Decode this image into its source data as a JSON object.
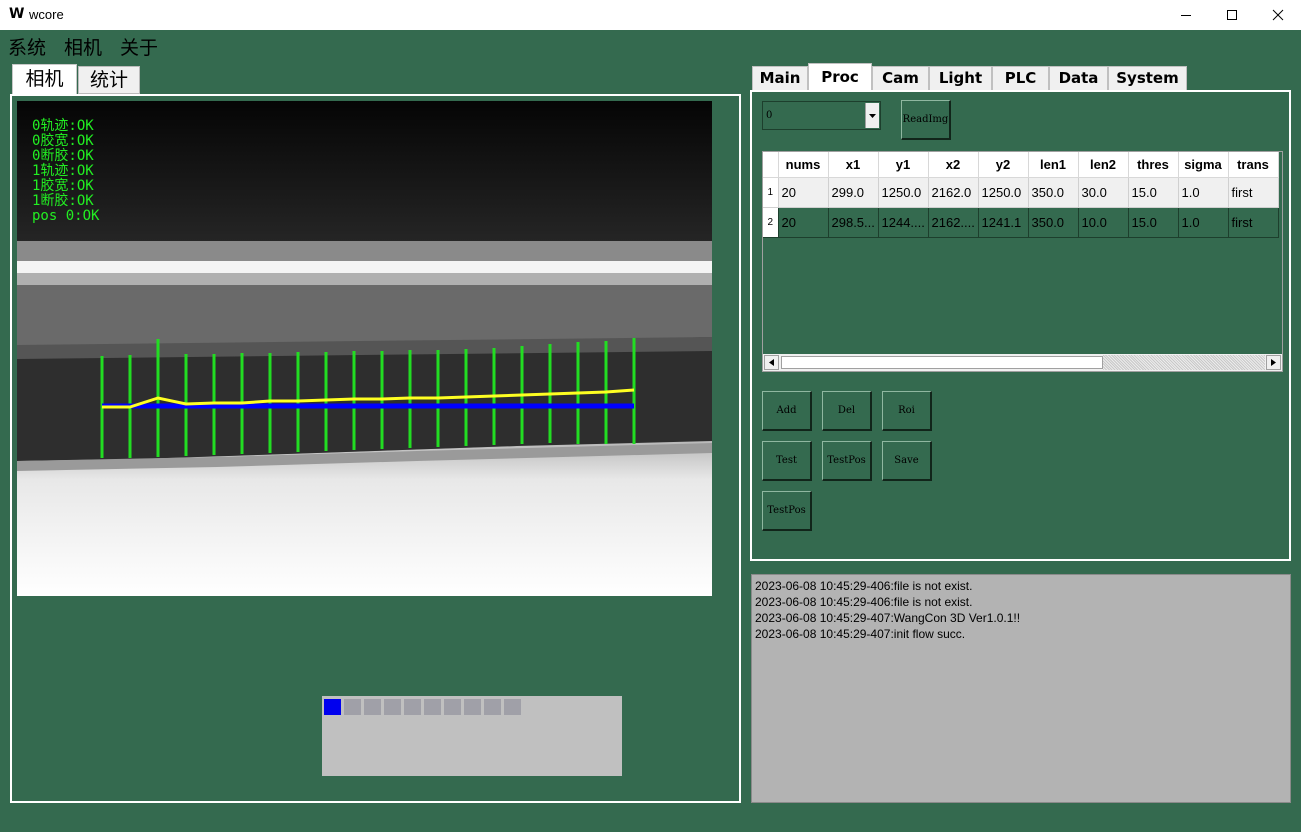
{
  "window": {
    "logo": "W",
    "title": "wcore",
    "controls": [
      "minimize-icon",
      "maximize-icon",
      "close-icon"
    ]
  },
  "menu": [
    "系统",
    "相机",
    "关于"
  ],
  "left_tabs": [
    {
      "label": "相机",
      "active": true
    },
    {
      "label": "统计",
      "active": false
    }
  ],
  "camera": {
    "status_lines": [
      "0轨迹:OK",
      "0胶宽:OK",
      "0断胶:OK",
      "1轨迹:OK",
      "1胶宽:OK",
      "1断胶:OK",
      "pos 0:OK"
    ],
    "overlay_colors": {
      "measure_lines": "#22dd22",
      "trajectory": "#ffff22",
      "baseline": "#0000ff"
    }
  },
  "thumbnails": {
    "count": 10,
    "active_index": 0,
    "active_color": "#0000ee"
  },
  "right_tabs": [
    {
      "label": "Main",
      "active": false
    },
    {
      "label": "Proc",
      "active": true
    },
    {
      "label": "Cam",
      "active": false
    },
    {
      "label": "Light",
      "active": false
    },
    {
      "label": "PLC",
      "active": false
    },
    {
      "label": "Data",
      "active": false
    },
    {
      "label": "System",
      "active": false
    }
  ],
  "proc": {
    "combo_value": "0",
    "readimg_label": "ReadImg",
    "table": {
      "columns": [
        "nums",
        "x1",
        "y1",
        "x2",
        "y2",
        "len1",
        "len2",
        "thres",
        "sigma",
        "trans"
      ],
      "rows": [
        {
          "index": "1",
          "cells": [
            "20",
            "299.0",
            "1250.0",
            "2162.0",
            "1250.0",
            "350.0",
            "30.0",
            "15.0",
            "1.0",
            "first"
          ]
        },
        {
          "index": "2",
          "cells": [
            "20",
            "298.5...",
            "1244....",
            "2162....",
            "1241.1",
            "350.0",
            "10.0",
            "15.0",
            "1.0",
            "first"
          ]
        }
      ]
    },
    "buttons": {
      "add": "Add",
      "del": "Del",
      "roi": "Roi",
      "test": "Test",
      "testpos": "TestPos",
      "save": "Save",
      "testpos2": "TestPos"
    }
  },
  "log": [
    "2023-06-08 10:45:29-406:file is not exist.",
    "2023-06-08 10:45:29-406:file is not exist.",
    "2023-06-08 10:45:29-407:WangCon 3D Ver1.0.1!!",
    "2023-06-08 10:45:29-407:init flow succ."
  ],
  "colors": {
    "background": "#346a4f",
    "log_background": "#b3b3b3"
  }
}
